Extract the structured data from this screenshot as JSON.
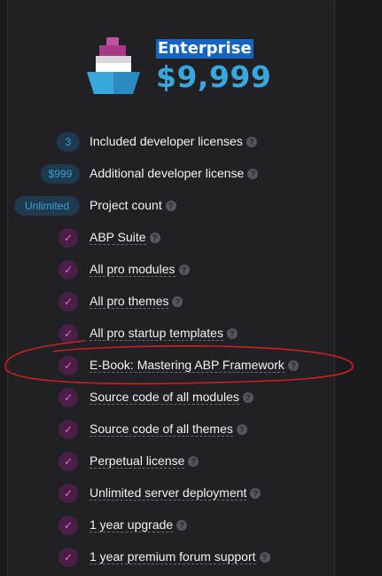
{
  "plan": {
    "name": "Enterprise",
    "price": "$9,999",
    "icon": "ship-icon"
  },
  "colors": {
    "background": "#1b1b1e",
    "card": "#212125",
    "price": "#3aa7dc",
    "selection_highlight": "#1565c0",
    "badge_bg": "#1e3a4e",
    "badge_text": "#3b9fd4",
    "check_bg": "#4a1f47",
    "check_fg": "#e86ad9",
    "annotation_stroke": "#cc2020"
  },
  "features": [
    {
      "badge": "3",
      "label": "Included developer licenses"
    },
    {
      "badge": "$999",
      "label": "Additional developer license"
    },
    {
      "badge": "Unlimited",
      "label": "Project count"
    },
    {
      "badge": null,
      "label": "ABP Suite"
    },
    {
      "badge": null,
      "label": "All pro modules"
    },
    {
      "badge": null,
      "label": "All pro themes"
    },
    {
      "badge": null,
      "label": "All pro startup templates"
    },
    {
      "badge": null,
      "label": "E-Book: Mastering ABP Framework"
    },
    {
      "badge": null,
      "label": "Source code of all modules"
    },
    {
      "badge": null,
      "label": "Source code of all themes"
    },
    {
      "badge": null,
      "label": "Perpetual license"
    },
    {
      "badge": null,
      "label": "Unlimited server deployment"
    },
    {
      "badge": null,
      "label": "1 year upgrade"
    },
    {
      "badge": null,
      "label": "1 year premium forum support"
    }
  ],
  "help_glyph": "?",
  "check_glyph": "✓"
}
